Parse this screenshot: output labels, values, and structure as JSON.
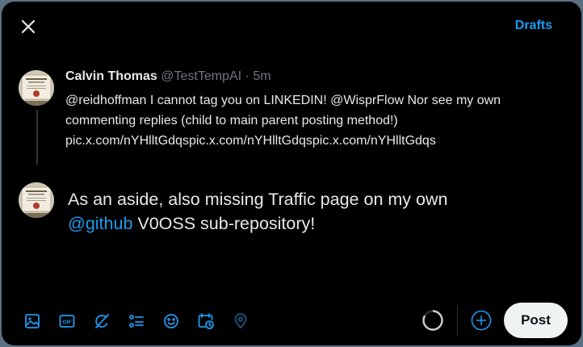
{
  "header": {
    "close_icon": "close-icon",
    "drafts_label": "Drafts"
  },
  "reply_to": {
    "name": "Calvin Thomas",
    "handle": "@TestTempAI",
    "separator": "·",
    "time": "5m",
    "lines": [
      "@reidhoffman I cannot tag you on LINKEDIN! @WisprFlow Nor see my own",
      "commenting replies (child to main parent posting method!)",
      "pic.x.com/nYHlltGdqspic.x.com/nYHlltGdqspic.x.com/nYHlltGdqs"
    ]
  },
  "compose": {
    "line1": "As an aside, also missing Traffic page on my own",
    "mention": "@github",
    "line2_rest": " V0OSS sub-repository!"
  },
  "toolbar": {
    "icons": [
      "image-icon",
      "gif-icon",
      "grok-icon",
      "poll-icon",
      "emoji-icon",
      "schedule-icon",
      "location-icon"
    ]
  },
  "actions": {
    "post_label": "Post",
    "progress_fraction": 0.83
  },
  "colors": {
    "accent": "#1d9bf0",
    "background": "#000000",
    "text": "#e7e9ea",
    "muted": "#71767b",
    "post_button": "#eff3f4"
  }
}
